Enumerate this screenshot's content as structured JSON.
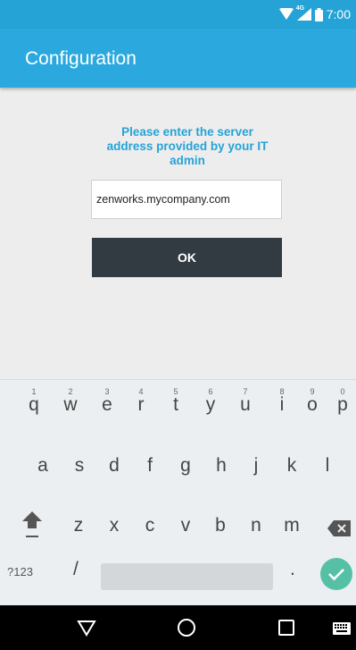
{
  "status_bar": {
    "time": "7:00",
    "network": "4G"
  },
  "app_bar": {
    "title": "Configuration"
  },
  "main": {
    "prompt": "Please enter the server address provided by your IT admin",
    "server_input_value": "zenworks.mycompany.com",
    "ok_label": "OK"
  },
  "keyboard": {
    "row1": [
      {
        "key": "q",
        "hint": "1"
      },
      {
        "key": "w",
        "hint": "2"
      },
      {
        "key": "e",
        "hint": "3"
      },
      {
        "key": "r",
        "hint": "4"
      },
      {
        "key": "t",
        "hint": "5"
      },
      {
        "key": "y",
        "hint": "6"
      },
      {
        "key": "u",
        "hint": "7"
      },
      {
        "key": "i",
        "hint": "8"
      },
      {
        "key": "o",
        "hint": "9"
      },
      {
        "key": "p",
        "hint": "0"
      }
    ],
    "row2": [
      "a",
      "s",
      "d",
      "f",
      "g",
      "h",
      "j",
      "k",
      "l"
    ],
    "row3": [
      "z",
      "x",
      "c",
      "v",
      "b",
      "n",
      "m"
    ],
    "symbols_label": "?123",
    "slash_label": "/",
    "period_label": "."
  },
  "colors": {
    "status_bar": "#26a3d6",
    "app_bar": "#2ba9de",
    "prompt_text": "#26a3d6",
    "ok_button": "#323b42",
    "done_key": "#56c0a6"
  }
}
